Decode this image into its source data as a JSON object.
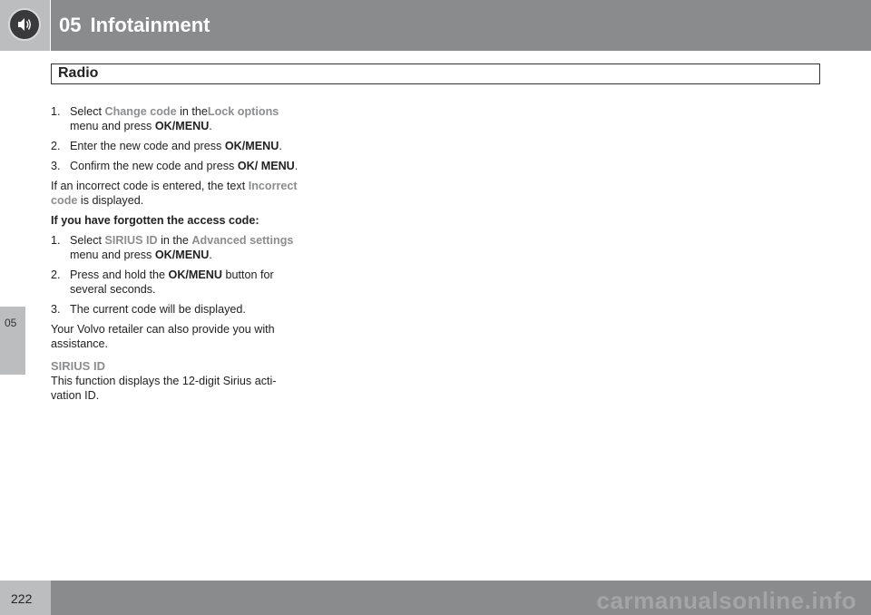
{
  "header": {
    "chapter_number": "05",
    "chapter_title": "Infotainment"
  },
  "section": {
    "title": "Radio"
  },
  "side_tab": {
    "label": "05"
  },
  "content": {
    "steps_change_code": [
      {
        "n": "1.",
        "pre": "Select ",
        "hl1": "Change code",
        "mid": " in the",
        "hl2": "Lock options",
        "post1": " menu and press ",
        "bold": "OK/MENU",
        "post2": "."
      },
      {
        "n": "2.",
        "pre": "Enter the new code and press ",
        "bold": "OK/MENU",
        "post": "."
      },
      {
        "n": "3.",
        "pre": "Confirm the new code and press ",
        "bold": "OK/ MENU",
        "post": "."
      }
    ],
    "incorrect_pre": "If an incorrect code is entered, the text ",
    "incorrect_hl": "Incorrect code",
    "incorrect_post": " is displayed.",
    "forgotten_heading": "If you have forgotten the access code:",
    "steps_forgotten": [
      {
        "n": "1.",
        "pre": "Select ",
        "hl1": "SIRIUS ID",
        "mid": " in the ",
        "hl2": "Advanced settings",
        "post1": " menu and press ",
        "bold": "OK/MENU",
        "post2": "."
      },
      {
        "n": "2.",
        "pre": "Press and hold the ",
        "bold": "OK/MENU",
        "post": " button for several seconds."
      },
      {
        "n": "3.",
        "text": "The current code will be displayed."
      }
    ],
    "assist_text": "Your Volvo retailer can also provide you with assistance.",
    "sirius_heading": "SIRIUS ID",
    "sirius_text": "This function displays the 12-digit Sirius acti-vation ID."
  },
  "footer": {
    "page_number": "222",
    "watermark": "carmanualsonline.info"
  },
  "colors": {
    "header_bar": "#8a8b8d",
    "icon_box": "#bcbdbf",
    "highlight_text": "#8c8d8f"
  },
  "icons": {
    "header": "speaker-icon"
  }
}
